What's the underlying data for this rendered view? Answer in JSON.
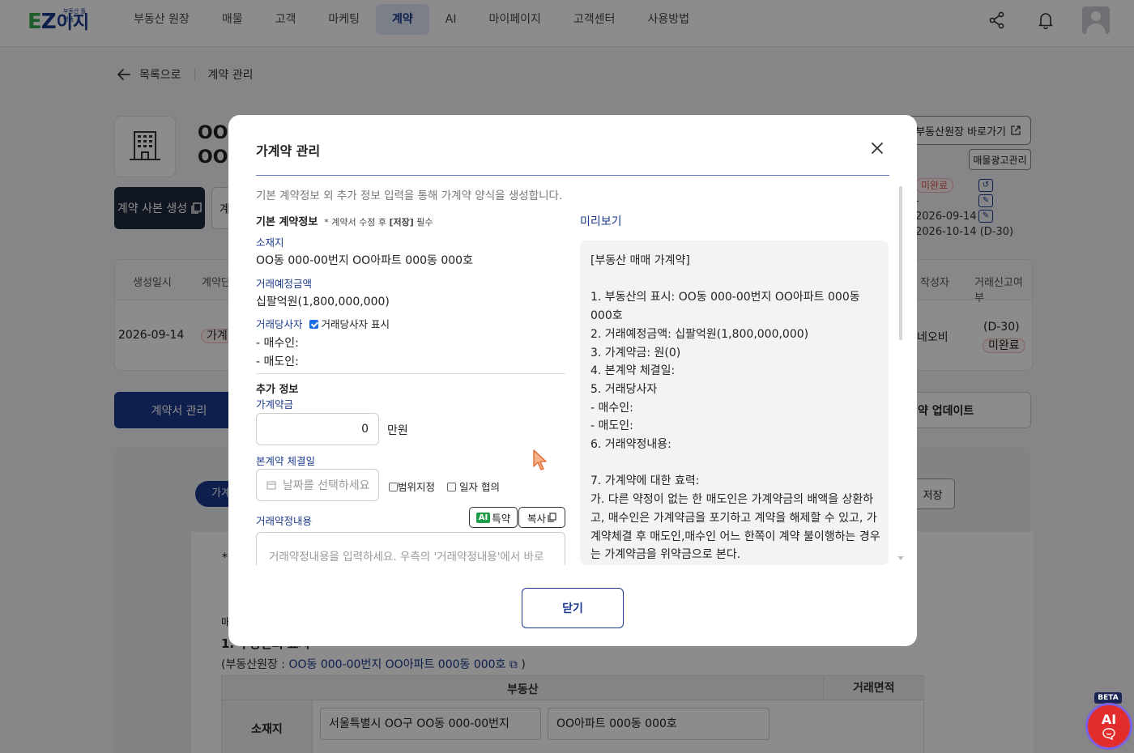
{
  "nav": {
    "logo_main": "EZ",
    "logo_sub": "이지",
    "logo_tag": "부동산 플랫폼",
    "menu": [
      "부동산 원장",
      "매물",
      "고객",
      "마케팅",
      "계약",
      "AI",
      "마이페이지",
      "고객센터",
      "사용방법"
    ],
    "active_index": 4
  },
  "page": {
    "back_label": "목록으로",
    "breadcrumb_current": "계약 관리",
    "property_title_1": "OO",
    "property_title_2": "OO",
    "copy_button": "계약 사본 생성",
    "copy_button2_partial": "계",
    "ledger_link": "부동산원장 바로가기",
    "ad_manage": "매물광고관리",
    "status_badge": "미완료",
    "info_dash": "-",
    "date1": "2026-09-14",
    "date2": "2026-10-14",
    "dday": "(D-30)",
    "table": {
      "headers": [
        "생성일시",
        "계약단",
        "작성자",
        "거래신고여부"
      ],
      "created": "2026-09-14",
      "type_badge": "가계",
      "writer": "네오비",
      "report_dday": "(D-30)",
      "report_status": "미완료"
    },
    "contract_manage_btn": "계약서 관리",
    "update_btn": "약 업데이트",
    "tab_pill": "가계",
    "save_btn": "저장",
    "doc_star": "*",
    "doc_ma": "매",
    "doc_section": "1. 부동산의 표시",
    "doc_sub_prefix": "(부동산원장 : ",
    "doc_sub_link": "OO동 000-00번지 OO아파트 000동 000호",
    "doc_sub_suffix": ")",
    "doc_table": {
      "h1": "부동산",
      "h2": "거래면적",
      "row_label": "소재지",
      "addr1": "서울특별시 OO구 OO동 000-00번지",
      "addr2": "OO아파트 000동 000호"
    }
  },
  "modal": {
    "title": "가계약 관리",
    "description": "기본 계약정보 외 추가 정보 입력을 통해 가계약 양식을 생성합니다.",
    "basic_heading": "기본 계약정보",
    "basic_note_pre": "* 계약서 수정 후 ",
    "basic_note_bold": "[저장]",
    "basic_note_post": " 필수",
    "location_label": "소재지",
    "location_value": "OO동 000-00번지 OO아파트 000동 000호",
    "price_label": "거래예정금액",
    "price_value": "십팔억원(1,800,000,000)",
    "parties_label": "거래당사자",
    "parties_checkbox": "거래당사자 표시",
    "buyer": "- 매수인:",
    "seller": "- 매도인:",
    "extra_heading": "추가 정보",
    "deposit_label": "가계약금",
    "deposit_value": "0",
    "deposit_unit": "만원",
    "main_date_label": "본계약 체결일",
    "date_placeholder": "날짜를 선택하세요",
    "range_checkbox": "범위지정",
    "negotiable_checkbox": "일자 협의",
    "terms_label": "거래약정내용",
    "ai_badge": "AI",
    "ai_button": "특약",
    "copy_button": "복사",
    "terms_placeholder": "거래약정내용을 입력하세요. 우측의 '거래약정내용'에서 바로",
    "preview_label": "미리보기",
    "preview_lines": [
      "[부동산 매매 가계약]",
      "",
      "1. 부동산의 표시: OO동 000-00번지 OO아파트 000동",
      "000호",
      "2. 거래예정금액: 십팔억원(1,800,000,000)",
      "3. 가계약금: 원(0)",
      "4. 본계약 체결일:",
      "5. 거래당사자",
      "- 매수인:",
      "- 매도인:",
      "6. 거래약정내용:",
      "",
      "7. 가계약에 대한 효력:",
      "가. 다른 약정이 없는 한 매도인은 가계약금의 배액을 상환하",
      "고, 매수인은 가계약금을 포기하고 계약을 해제할 수 있고, 가",
      "계약체결 후 매도인,매수인 어느 한쪽이 계약 불이행하는 경우",
      "는 가계약금을 위약금으로 본다."
    ],
    "close_button": "닫기"
  },
  "fab": {
    "beta": "BETA",
    "label": "AI"
  }
}
